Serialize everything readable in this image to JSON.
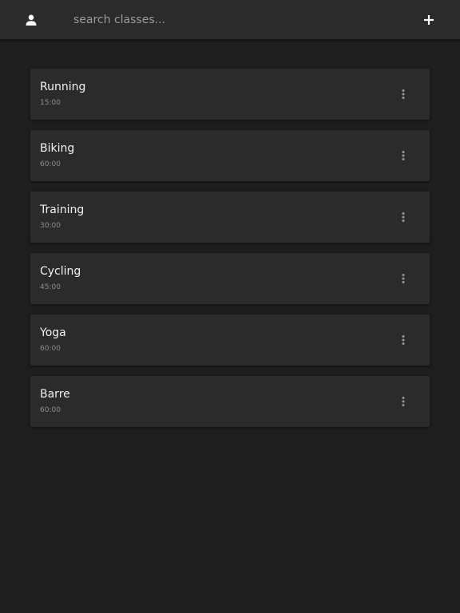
{
  "header": {
    "profile_icon": "person-icon",
    "search": {
      "placeholder": "search classes...",
      "value": ""
    },
    "add_icon": "plus-icon"
  },
  "classes": [
    {
      "name": "Running",
      "duration": "15:00"
    },
    {
      "name": "Biking",
      "duration": "60:00"
    },
    {
      "name": "Training",
      "duration": "30:00"
    },
    {
      "name": "Cycling",
      "duration": "45:00"
    },
    {
      "name": "Yoga",
      "duration": "60:00"
    },
    {
      "name": "Barre",
      "duration": "60:00"
    }
  ],
  "colors": {
    "background": "#1e1e1e",
    "surface": "#2b2b2b",
    "text_primary": "#f2f2f2",
    "text_secondary": "#8e8e8e",
    "icon": "#ffffff"
  }
}
